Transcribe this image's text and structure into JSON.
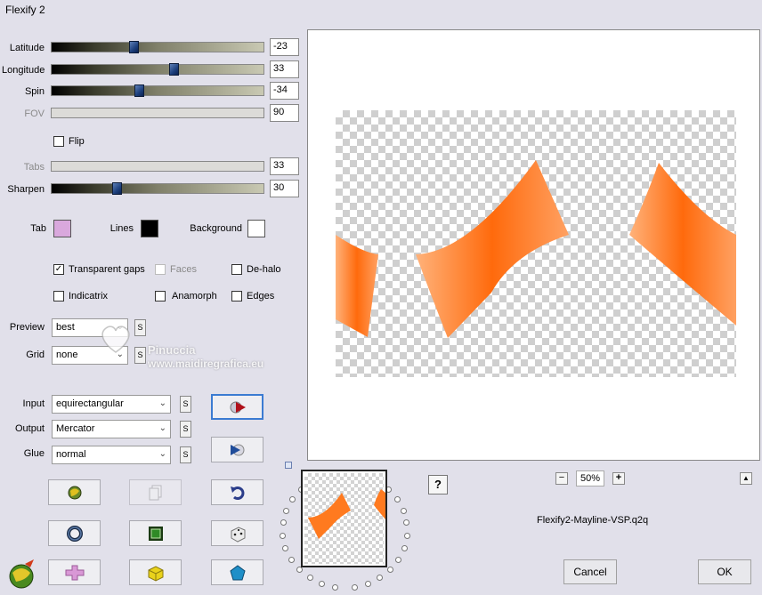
{
  "window": {
    "title": "Flexify 2"
  },
  "sliders": [
    {
      "label": "Latitude",
      "value": "-23",
      "enabled": true,
      "level": 0.38
    },
    {
      "label": "Longitude",
      "value": "33",
      "enabled": true,
      "level": 0.58
    },
    {
      "label": "Spin",
      "value": "-34",
      "enabled": true,
      "level": 0.41
    },
    {
      "label": "FOV",
      "value": "90",
      "enabled": false,
      "level": null
    },
    {
      "label": "Tabs",
      "value": "33",
      "enabled": false,
      "level": null
    },
    {
      "label": "Sharpen",
      "value": "30",
      "enabled": true,
      "level": 0.3
    }
  ],
  "flip": {
    "label": "Flip",
    "checked": false
  },
  "colors": {
    "tab": {
      "label": "Tab",
      "color": "#d9a8dd"
    },
    "lines": {
      "label": "Lines",
      "color": "#000000"
    },
    "background": {
      "label": "Background",
      "color": "#ffffff"
    }
  },
  "options": {
    "transparent_gaps": {
      "label": "Transparent gaps",
      "checked": true
    },
    "faces": {
      "label": "Faces",
      "checked": false,
      "enabled": false
    },
    "dehalo": {
      "label": "De-halo",
      "checked": false
    },
    "indicatrix": {
      "label": "Indicatrix",
      "checked": false
    },
    "anamorph": {
      "label": "Anamorph",
      "checked": false
    },
    "edges": {
      "label": "Edges",
      "checked": false
    }
  },
  "preview_select": {
    "label": "Preview",
    "value": "best"
  },
  "grid_select": {
    "label": "Grid",
    "value": "none"
  },
  "input_select": {
    "label": "Input",
    "value": "equirectangular"
  },
  "output_select": {
    "label": "Output",
    "value": "Mercator"
  },
  "glue_select": {
    "label": "Glue",
    "value": "normal"
  },
  "s_button": "S",
  "watermark": {
    "line1": "Pinuccia",
    "line2": "www.maidiregrafica.eu"
  },
  "zoom": {
    "value": "50%",
    "minus": "−",
    "plus": "+"
  },
  "help": "?",
  "preset_name": "Flexify2-Mayline-VSP.q2q",
  "buttons": {
    "cancel": "Cancel",
    "ok": "OK"
  },
  "accent": "#ff7a1f"
}
